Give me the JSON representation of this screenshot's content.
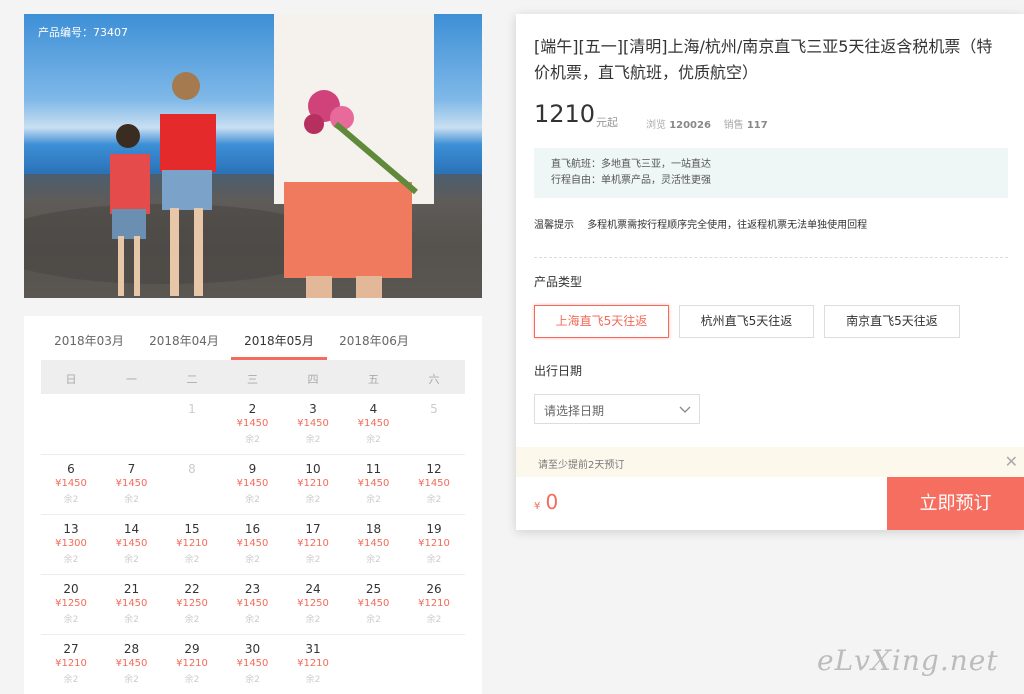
{
  "photo": {
    "product_code": "产品编号：73407"
  },
  "calendar": {
    "months": [
      {
        "label": "2018年03月",
        "active": false
      },
      {
        "label": "2018年04月",
        "active": false
      },
      {
        "label": "2018年05月",
        "active": true
      },
      {
        "label": "2018年06月",
        "active": false
      }
    ],
    "weekdays": [
      "日",
      "一",
      "二",
      "三",
      "四",
      "五",
      "六"
    ],
    "weeks": [
      [
        {
          "d": "",
          "p": "",
          "s": ""
        },
        {
          "d": "",
          "p": "",
          "s": ""
        },
        {
          "d": "1",
          "p": "",
          "s": "",
          "dis": true
        },
        {
          "d": "2",
          "p": "¥1450",
          "s": "余2"
        },
        {
          "d": "3",
          "p": "¥1450",
          "s": "余2"
        },
        {
          "d": "4",
          "p": "¥1450",
          "s": "余2"
        },
        {
          "d": "5",
          "p": "",
          "s": "",
          "dis": true
        }
      ],
      [
        {
          "d": "6",
          "p": "¥1450",
          "s": "余2"
        },
        {
          "d": "7",
          "p": "¥1450",
          "s": "余2"
        },
        {
          "d": "8",
          "p": "",
          "s": "",
          "dis": true
        },
        {
          "d": "9",
          "p": "¥1450",
          "s": "余2"
        },
        {
          "d": "10",
          "p": "¥1210",
          "s": "余2"
        },
        {
          "d": "11",
          "p": "¥1450",
          "s": "余2"
        },
        {
          "d": "12",
          "p": "¥1450",
          "s": "余2"
        }
      ],
      [
        {
          "d": "13",
          "p": "¥1300",
          "s": "余2"
        },
        {
          "d": "14",
          "p": "¥1450",
          "s": "余2"
        },
        {
          "d": "15",
          "p": "¥1210",
          "s": "余2"
        },
        {
          "d": "16",
          "p": "¥1450",
          "s": "余2"
        },
        {
          "d": "17",
          "p": "¥1210",
          "s": "余2"
        },
        {
          "d": "18",
          "p": "¥1450",
          "s": "余2"
        },
        {
          "d": "19",
          "p": "¥1210",
          "s": "余2"
        }
      ],
      [
        {
          "d": "20",
          "p": "¥1250",
          "s": "余2"
        },
        {
          "d": "21",
          "p": "¥1450",
          "s": "余2"
        },
        {
          "d": "22",
          "p": "¥1250",
          "s": "余2"
        },
        {
          "d": "23",
          "p": "¥1450",
          "s": "余2"
        },
        {
          "d": "24",
          "p": "¥1250",
          "s": "余2"
        },
        {
          "d": "25",
          "p": "¥1450",
          "s": "余2"
        },
        {
          "d": "26",
          "p": "¥1210",
          "s": "余2"
        }
      ],
      [
        {
          "d": "27",
          "p": "¥1210",
          "s": "余2"
        },
        {
          "d": "28",
          "p": "¥1450",
          "s": "余2"
        },
        {
          "d": "29",
          "p": "¥1210",
          "s": "余2"
        },
        {
          "d": "30",
          "p": "¥1450",
          "s": "余2"
        },
        {
          "d": "31",
          "p": "¥1210",
          "s": "余2"
        },
        {
          "d": "",
          "p": "",
          "s": ""
        },
        {
          "d": "",
          "p": "",
          "s": ""
        }
      ]
    ]
  },
  "product": {
    "title": "[端午][五一][清明]上海/杭州/南京直飞三亚5天往返含税机票（特价机票，直飞航班，优质航空）",
    "price": "1210",
    "price_unit": "元起",
    "views_label": "浏览",
    "views": "120026",
    "sales_label": "销售",
    "sales": "117",
    "features": [
      "直飞航班：多地直飞三亚，一站直达",
      "行程自由：单机票产品，灵活性更强"
    ],
    "tip_title": "温馨提示",
    "tip_text": "多程机票需按行程顺序完全使用，往返程机票无法单独使用回程",
    "type_label": "产品类型",
    "types": [
      "上海直飞5天往返",
      "杭州直飞5天往返",
      "南京直飞5天往返"
    ],
    "date_label": "出行日期",
    "date_placeholder": "请选择日期",
    "notice": "请至少提前2天预订",
    "total_currency": "¥",
    "total": "0",
    "book_label": "立即预订"
  },
  "watermark": "eLvXing.net",
  "colors": {
    "accent": "#f36b5a",
    "feature_bg": "#eff7f6",
    "notice_bg": "#fdf8ec"
  }
}
